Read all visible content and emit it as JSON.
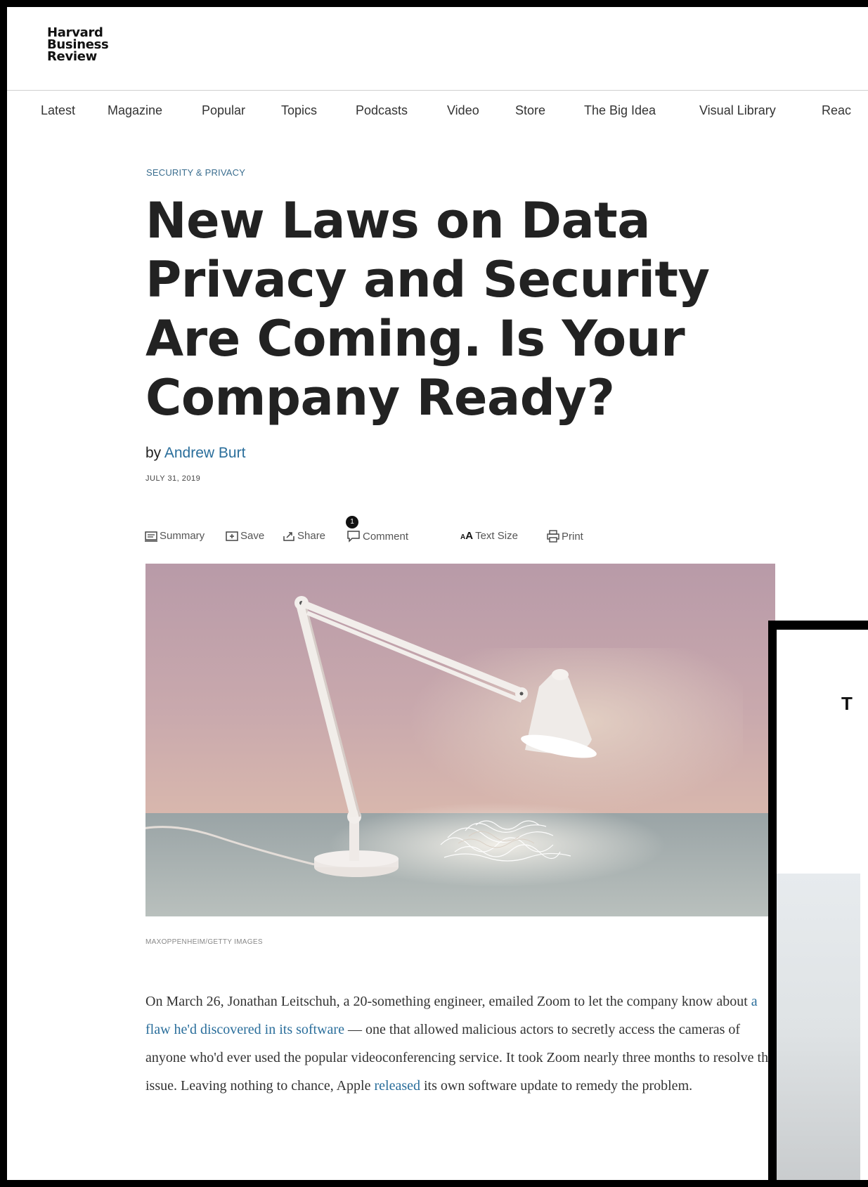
{
  "header": {
    "logo_lines": [
      "Harvard",
      "Business",
      "Review"
    ]
  },
  "nav": {
    "items": [
      "Latest",
      "Magazine",
      "Popular",
      "Topics",
      "Podcasts",
      "Video",
      "Store",
      "The Big Idea",
      "Visual Library",
      "Reac"
    ]
  },
  "article": {
    "kicker": "SECURITY & PRIVACY",
    "title": "New Laws on Data Privacy and Security Are Coming. Is Your Company Ready?",
    "by_prefix": "by",
    "author": "Andrew Burt",
    "date": "JULY 31, 2019",
    "toolbar": {
      "summary": "Summary",
      "save": "Save",
      "share": "Share",
      "comment": "Comment",
      "comment_count": "1",
      "text_size": "Text Size",
      "print": "Print"
    },
    "image_credit": "MAXOPPENHEIM/GETTY IMAGES",
    "body": {
      "p1_a": "On March 26, Jonathan Leitschuh, a 20-something engineer, emailed Zoom to let the company know about ",
      "p1_link1": "a flaw he'd discovered in its software",
      "p1_b": " — one that allowed malicious actors to secretly access the cameras of anyone who'd ever used the popular videoconferencing service. It took Zoom nearly three months to resolve the issue. Leaving nothing to chance, Apple ",
      "p1_link2": "released",
      "p1_c": " its own software update to remedy the problem."
    }
  },
  "overlay": {
    "title_fragment": "T"
  },
  "colors": {
    "link": "#2a6e9b",
    "kicker": "#3b6e8f",
    "frame": "#000000"
  }
}
